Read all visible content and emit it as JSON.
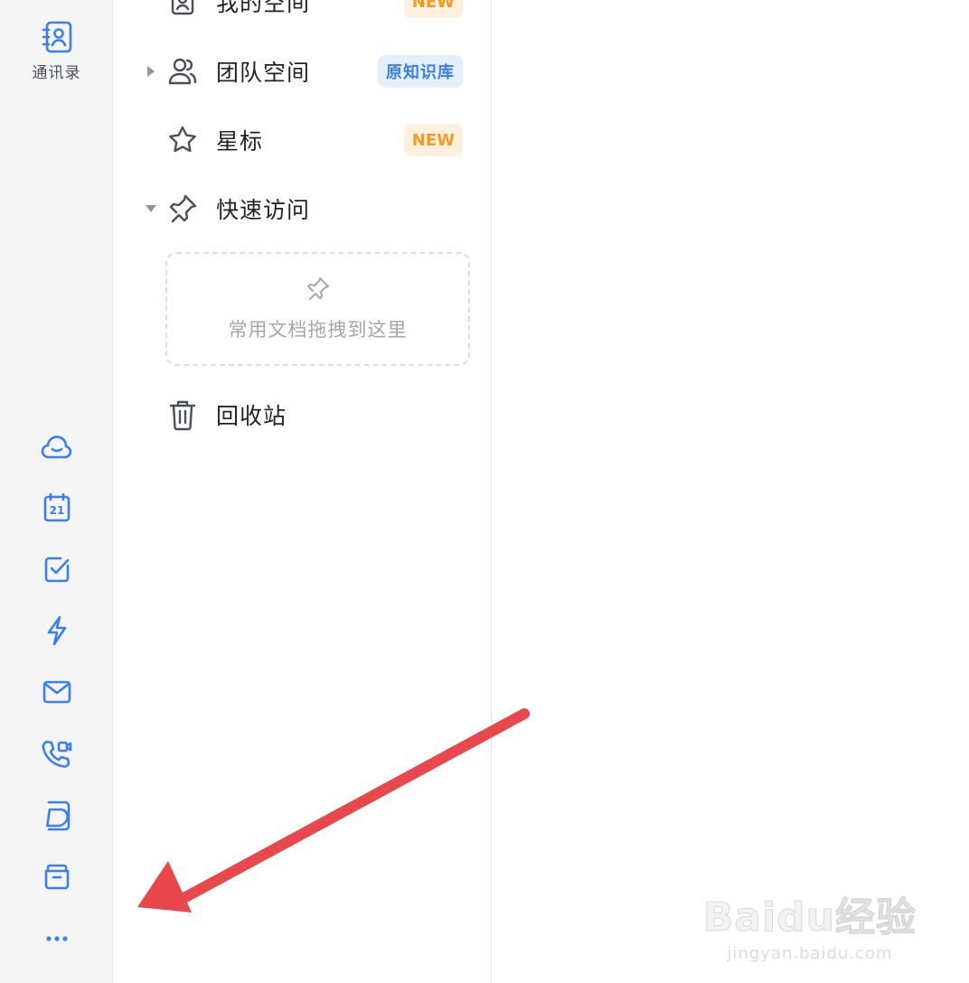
{
  "rail": {
    "contacts_label": "通讯录",
    "icons": [
      "contacts-icon",
      "cloud-icon",
      "calendar-icon",
      "tasks-icon",
      "lightning-icon",
      "mail-icon",
      "video-call-icon",
      "docs-icon",
      "folder-icon",
      "more-icon"
    ],
    "calendar_day": "21",
    "accent_color": "#3a7ff2"
  },
  "sidebar": {
    "items": [
      {
        "label": "我的空间",
        "badge": "NEW",
        "icon": "person-card-icon"
      },
      {
        "label": "团队空间",
        "badge": "原知识库",
        "icon": "team-icon"
      },
      {
        "label": "星标",
        "badge": "NEW",
        "icon": "star-icon"
      },
      {
        "label": "快速访问",
        "icon": "pin-icon"
      },
      {
        "label": "回收站",
        "icon": "trash-icon"
      }
    ],
    "drop_zone_text": "常用文档拖拽到这里"
  },
  "watermark": {
    "logo": "Baidu经验",
    "url": "jingyan.baidu.com"
  },
  "colors": {
    "new_badge_bg": "#fdf0de",
    "new_badge_text": "#f59a23",
    "blue_badge_bg": "#e3effd",
    "blue_badge_text": "#3b7ee6",
    "annotation_arrow": "#e8474c"
  }
}
